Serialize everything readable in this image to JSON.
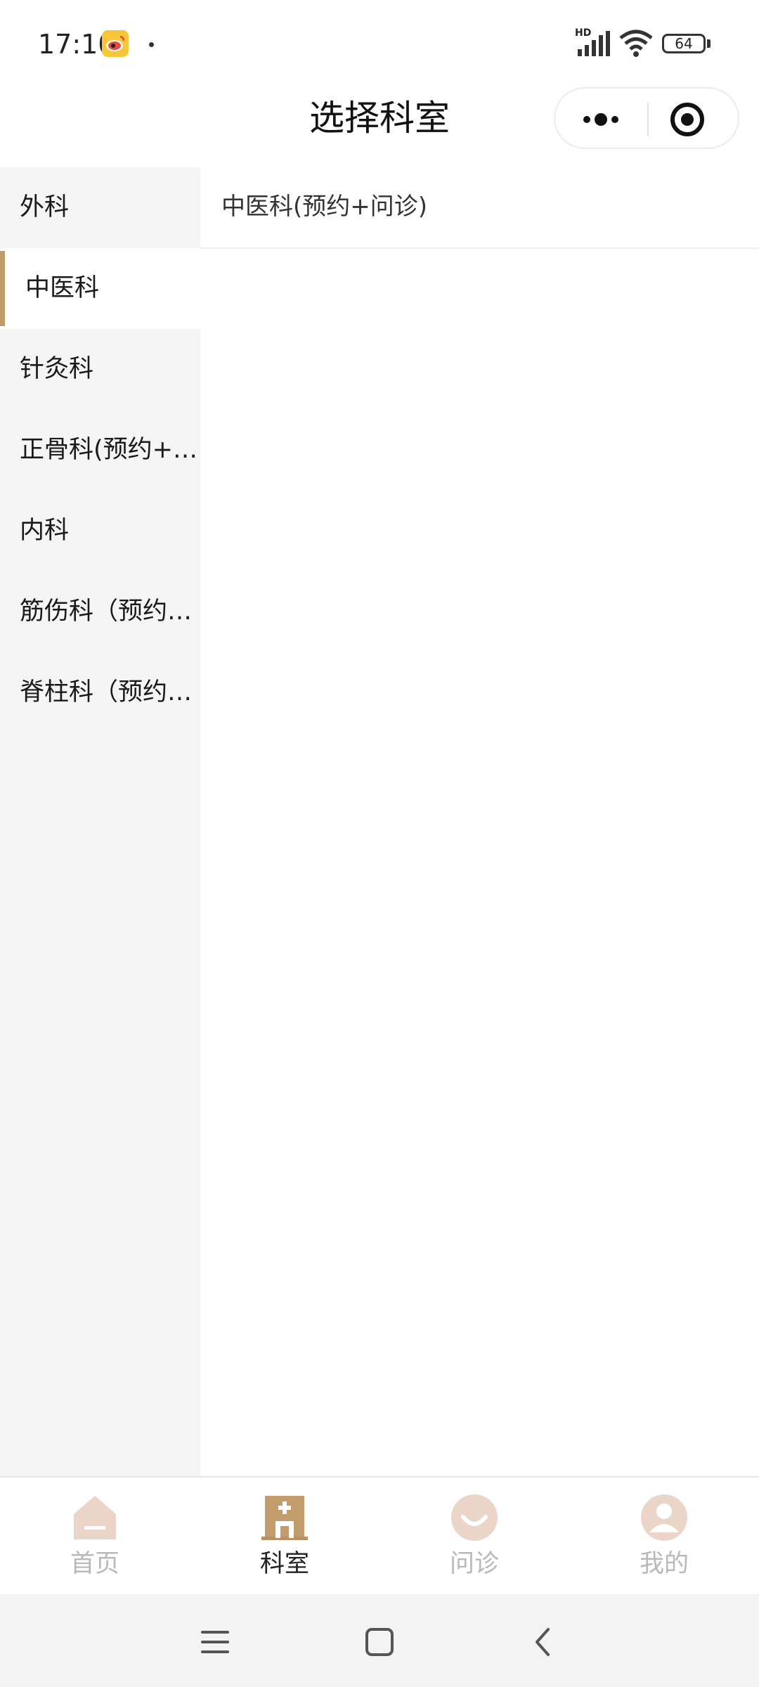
{
  "status_bar": {
    "time": "17:10",
    "network_label": "HD",
    "battery_level": "64",
    "icons": [
      "weibo-icon",
      "signal-icon",
      "wifi-icon",
      "battery-icon"
    ]
  },
  "header": {
    "title": "选择科室",
    "icons": [
      "more-icon",
      "close-mini-program-icon"
    ]
  },
  "sidebar": {
    "items": [
      {
        "label": "外科",
        "active": false
      },
      {
        "label": "中医科",
        "active": true
      },
      {
        "label": "针灸科",
        "active": false
      },
      {
        "label": "正骨科(预约+…",
        "active": false
      },
      {
        "label": "内科",
        "active": false
      },
      {
        "label": "筋伤科（预约…",
        "active": false
      },
      {
        "label": "脊柱科（预约…",
        "active": false
      }
    ]
  },
  "content": {
    "items": [
      {
        "label": "中医科(预约+问诊)"
      }
    ]
  },
  "tab_bar": {
    "tabs": [
      {
        "label": "首页",
        "icon": "home-icon",
        "active": false
      },
      {
        "label": "科室",
        "icon": "department-icon",
        "active": true
      },
      {
        "label": "问诊",
        "icon": "consult-icon",
        "active": false
      },
      {
        "label": "我的",
        "icon": "profile-icon",
        "active": false
      }
    ]
  },
  "system_nav": {
    "icons": [
      "menu-icon",
      "home-square-icon",
      "back-icon"
    ]
  },
  "colors": {
    "accent": "#c39c6b",
    "accent_dark": "#b89264",
    "inactive_icon": "#ead5c8",
    "sidebar_bg": "#f5f5f5"
  }
}
